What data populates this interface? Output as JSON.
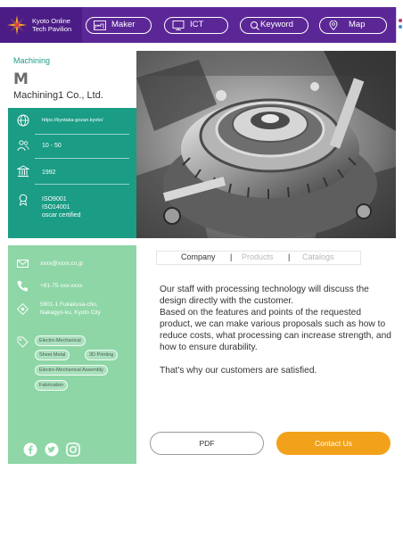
{
  "header": {
    "logo_line1": "Kyoto Online",
    "logo_line2": "Tech Pavilion",
    "nav": [
      {
        "label": "Maker",
        "icon": "factory-icon"
      },
      {
        "label": "ICT",
        "icon": "monitor-icon"
      },
      {
        "label": "Keyword",
        "icon": "search-icon"
      },
      {
        "label": "Map",
        "icon": "map-pin-icon"
      }
    ]
  },
  "company": {
    "category": "Machining",
    "logo_mark": "M",
    "name": "Machining1 Co., Ltd.",
    "website": "https://kyotaka-gozan.kyoto/",
    "employees": "10 - 50",
    "founded": "1992",
    "certifications": [
      "ISO9001",
      "ISO14001",
      "oscar certified"
    ]
  },
  "contact": {
    "email": "xxxx@xxxx.co.jp",
    "phone": "+81-75-xxx-xxxx",
    "address_line1": "5901-1 Fukakusa-cho,",
    "address_line2": "Nakagyo-ku, Kyoto City",
    "tags": [
      "Electro-Mechanical",
      "Sheet Metal",
      "3D Printing",
      "Electro-Mechanical Assembly",
      "Fabrication"
    ]
  },
  "tabs": {
    "items": [
      "Company",
      "Products",
      "Catalogs"
    ],
    "separator": "|"
  },
  "description": {
    "line1": "Our staff with processing technology will discuss the design directly with the customer.",
    "line2": "Based on the features and points of the requested product, we can make various proposals such as how to reduce costs, what processing can increase strength, and how to ensure durability.",
    "closing": "That's why our customers are satisfied."
  },
  "buttons": {
    "pdf": "PDF",
    "contact": "Contact Us"
  },
  "colors": {
    "nav_purple": "#5b2796",
    "teal": "#1a9c85",
    "mint": "#8ed6a6",
    "orange": "#f2a21a",
    "tab_active": "#333333",
    "tab_inactive": "#b8b8b8"
  }
}
